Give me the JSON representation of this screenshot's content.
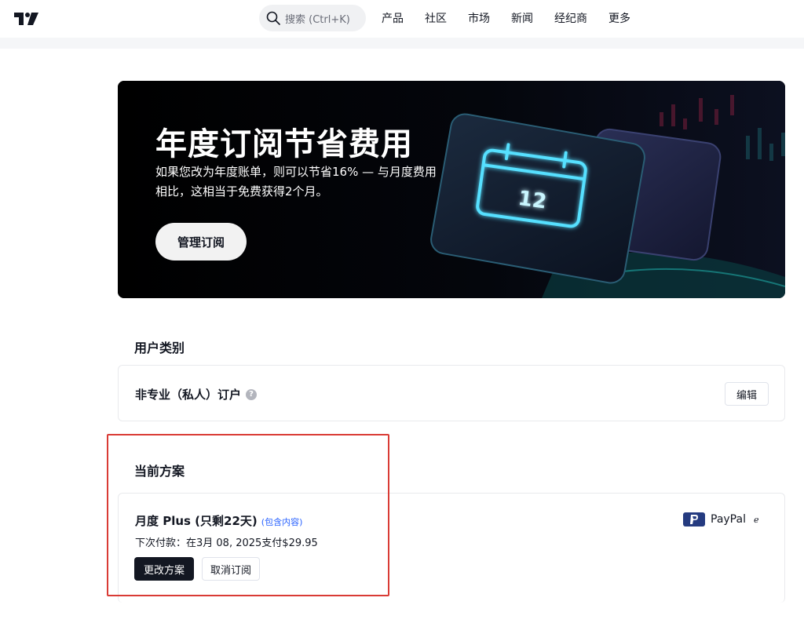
{
  "header": {
    "search": {
      "placeholder": "搜索 (Ctrl+K)"
    },
    "nav": [
      "产品",
      "社区",
      "市场",
      "新闻",
      "经纪商",
      "更多"
    ]
  },
  "banner": {
    "title": "年度订阅节省费用",
    "text_line1": "如果您改为年度账单，则可以节省16% — 与月度费用",
    "text_line2": "相比，这相当于免费获得2个月。",
    "button_label": "管理订阅",
    "calendar_number": "12"
  },
  "user_category": {
    "section_title": "用户类别",
    "type_label": "非专业（私人）订户",
    "help_icon": "?",
    "edit_label": "编辑"
  },
  "current_plan": {
    "section_title": "当前方案",
    "plan_name": "月度 Plus (只剩22天)",
    "include_link": "(包含内容)",
    "next_payment": "下次付款：在3月 08, 2025支付$29.95",
    "change_label": "更改方案",
    "cancel_label": "取消订阅",
    "payment_method": "PayPal",
    "payment_trailing": "ℯ"
  },
  "colors": {
    "accent_link": "#2962ff",
    "highlight": "#d93b35",
    "banner_glow": "#56e0ff",
    "primary_button": "#131722"
  },
  "icons": [
    "tradingview-logo-icon",
    "search-icon",
    "help-icon",
    "calendar-icon",
    "paypal-icon"
  ]
}
